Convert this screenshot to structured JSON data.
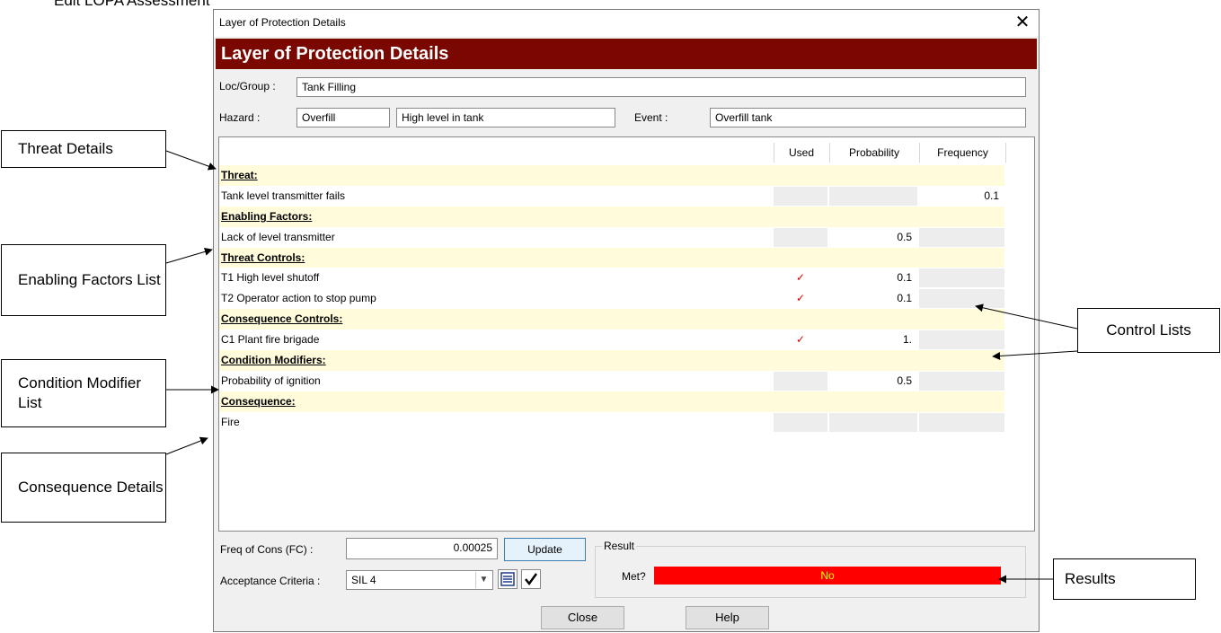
{
  "background_title": "Edit LOPA Assessment",
  "window": {
    "title": "Layer of Protection Details",
    "close_icon": "close-icon"
  },
  "banner": "Layer of Protection Details",
  "fields": {
    "loc_group_label": "Loc/Group :",
    "loc_group_value": "Tank Filling",
    "hazard_label": "Hazard :",
    "hazard_code": "Overfill",
    "hazard_desc": "High level in tank",
    "event_label": "Event :",
    "event_value": "Overfill tank"
  },
  "grid": {
    "headers": {
      "used": "Used",
      "probability": "Probability",
      "frequency": "Frequency"
    },
    "rows": [
      {
        "type": "section",
        "name": "Threat:"
      },
      {
        "type": "item",
        "name": "Tank level transmitter fails",
        "used": "",
        "probability": "",
        "frequency": "0.1"
      },
      {
        "type": "section",
        "name": "Enabling Factors:"
      },
      {
        "type": "item",
        "name": "Lack of level transmitter",
        "used": "",
        "probability": "0.5",
        "frequency": ""
      },
      {
        "type": "section",
        "name": "Threat Controls:"
      },
      {
        "type": "item",
        "name": "T1 High level shutoff",
        "used": "✓",
        "probability": "0.1",
        "frequency": ""
      },
      {
        "type": "item",
        "name": "T2 Operator action to stop pump",
        "used": "✓",
        "probability": "0.1",
        "frequency": ""
      },
      {
        "type": "section",
        "name": "Consequence Controls:"
      },
      {
        "type": "item",
        "name": "C1 Plant fire brigade",
        "used": "✓",
        "probability": "1.",
        "frequency": ""
      },
      {
        "type": "section",
        "name": "Condition Modifiers:"
      },
      {
        "type": "item",
        "name": "Probability of ignition",
        "used": "",
        "probability": "0.5",
        "frequency": ""
      },
      {
        "type": "section",
        "name": "Consequence:"
      },
      {
        "type": "item",
        "name": "Fire",
        "used": "",
        "probability": "",
        "frequency": ""
      }
    ]
  },
  "bottom": {
    "freq_label": "Freq of Cons (FC) :",
    "freq_value": "0.00025",
    "update_label": "Update",
    "result_legend": "Result",
    "met_label": "Met?",
    "met_value": "No",
    "acceptance_label": "Acceptance Criteria :",
    "acceptance_value": "SIL 4"
  },
  "footer": {
    "close_label": "Close",
    "help_label": "Help"
  },
  "callouts": {
    "threat_details": "Threat Details",
    "enabling_factors": "Enabling Factors List",
    "condition_modifier": "Condition Modifier List",
    "consequence_details": "Consequence Details",
    "control_lists": "Control Lists",
    "results": "Results"
  },
  "colors": {
    "banner": "#7a0800",
    "section_row": "#fffbdb",
    "met_bar": "#ff0000",
    "met_text": "#ffff00",
    "check": "#e00000"
  }
}
